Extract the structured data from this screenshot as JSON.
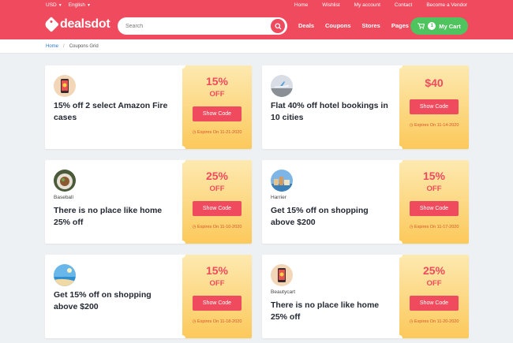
{
  "topbar": {
    "currency": "USD",
    "language": "English",
    "links": [
      "Home",
      "Wishlist",
      "My account",
      "Contact",
      "Become a Vendor"
    ]
  },
  "brand": {
    "name": "dealsdot"
  },
  "search": {
    "placeholder": "Search"
  },
  "nav": [
    "Deals",
    "Coupons",
    "Stores",
    "Pages"
  ],
  "cart": {
    "label": "My Cart",
    "count": "1"
  },
  "breadcrumb": {
    "home": "Home",
    "current": "Coupons Grid"
  },
  "colors": {
    "brand": "#ef4a5d",
    "cart": "#4fc35e",
    "coupon_bg": "#fcc95b"
  },
  "coupons": [
    {
      "store": "",
      "title": "15% off 2 select Amazon Fire cases",
      "percent": "15%",
      "off": "OFF",
      "button": "Show Code",
      "expires": "Expires On 11-21-2020",
      "thumb": "phone-icon"
    },
    {
      "store": "",
      "title": "Flat 40% off hotel bookings in 10 cities",
      "value": "$40",
      "button": "Show Code",
      "expires": "Expires On 11-14-2020",
      "thumb": "airplane-icon"
    },
    {
      "store": "Baseball",
      "title": "There is no place like home 25% off",
      "percent": "25%",
      "off": "OFF",
      "button": "Show Code",
      "expires": "Expires On 11-10-2020",
      "thumb": "plate-icon"
    },
    {
      "store": "Harrier",
      "title": "Get 15% off on shopping above $200",
      "percent": "15%",
      "off": "OFF",
      "button": "Show Code",
      "expires": "Expires On 11-17-2020",
      "thumb": "city-icon"
    },
    {
      "store": "",
      "title": "Get 15% off on shopping above $200",
      "percent": "15%",
      "off": "OFF",
      "button": "Show Code",
      "expires": "Expires On 11-18-2020",
      "thumb": "beach-icon"
    },
    {
      "store": "Beautycart",
      "title": "There is no place like home 25% off",
      "percent": "25%",
      "off": "OFF",
      "button": "Show Code",
      "expires": "Expires On 11-20-2020",
      "thumb": "phone-icon"
    }
  ]
}
